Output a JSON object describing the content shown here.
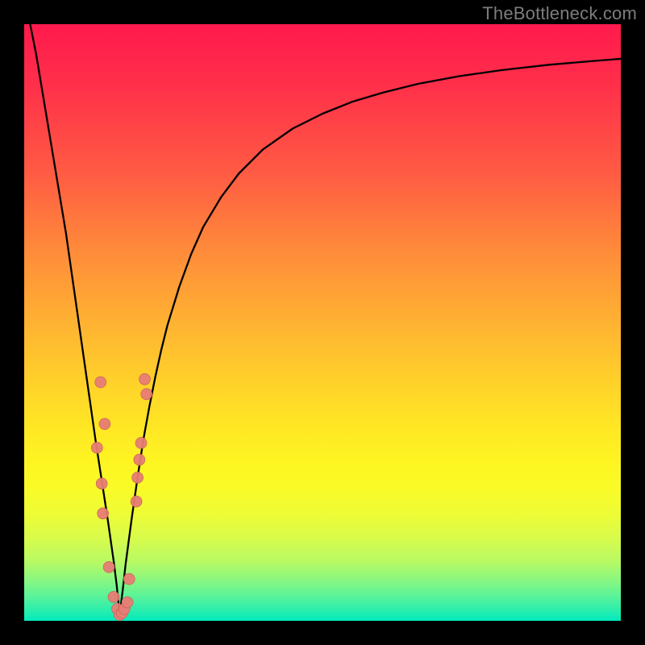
{
  "watermark": {
    "text": "TheBottleneck.com"
  },
  "colors": {
    "frame": "#000000",
    "curve": "#000000",
    "dot_fill": "#e77c74",
    "dot_stroke": "#c65b52",
    "gradient_top": "#ff1a4d",
    "gradient_bottom": "#00e9be"
  },
  "chart_data": {
    "type": "line",
    "title": "",
    "xlabel": "",
    "ylabel": "",
    "xlim": [
      0,
      100
    ],
    "ylim": [
      0,
      100
    ],
    "grid": false,
    "legend": false,
    "bottleneck_x": 16,
    "series": [
      {
        "name": "bottleneck-curve",
        "x": [
          1,
          2,
          3,
          4,
          5,
          6,
          7,
          8,
          9,
          10,
          11,
          12,
          13,
          14,
          15,
          15.5,
          16,
          16.5,
          17,
          18,
          19,
          20,
          21,
          22,
          23,
          24,
          26,
          28,
          30,
          33,
          36,
          40,
          45,
          50,
          55,
          60,
          66,
          73,
          80,
          88,
          95,
          100
        ],
        "y": [
          100,
          95,
          89,
          83,
          77,
          71,
          65,
          58,
          51,
          44,
          37,
          30,
          23.5,
          17,
          10,
          6,
          1,
          5,
          9.5,
          17,
          24,
          30.5,
          36,
          41,
          45.5,
          49.5,
          56,
          61.5,
          66,
          71,
          75,
          79,
          82.5,
          85,
          87,
          88.5,
          90,
          91.3,
          92.3,
          93.2,
          93.8,
          94.2
        ]
      }
    ],
    "points": [
      {
        "name": "pt-a",
        "x": 12.2,
        "y": 29.0
      },
      {
        "name": "pt-b",
        "x": 12.8,
        "y": 40.0
      },
      {
        "name": "pt-c",
        "x": 13.0,
        "y": 23.0
      },
      {
        "name": "pt-d",
        "x": 13.2,
        "y": 18.0
      },
      {
        "name": "pt-e",
        "x": 13.5,
        "y": 33.0
      },
      {
        "name": "pt-f",
        "x": 14.2,
        "y": 9.0
      },
      {
        "name": "pt-g",
        "x": 15.0,
        "y": 4.0
      },
      {
        "name": "pt-h",
        "x": 15.6,
        "y": 2.0
      },
      {
        "name": "pt-i",
        "x": 16.0,
        "y": 1.0
      },
      {
        "name": "pt-j",
        "x": 16.4,
        "y": 1.3
      },
      {
        "name": "pt-k",
        "x": 16.8,
        "y": 2.0
      },
      {
        "name": "pt-l",
        "x": 17.3,
        "y": 3.1
      },
      {
        "name": "pt-m",
        "x": 17.6,
        "y": 7.0
      },
      {
        "name": "pt-n",
        "x": 18.8,
        "y": 20.0
      },
      {
        "name": "pt-o",
        "x": 19.0,
        "y": 24.0
      },
      {
        "name": "pt-p",
        "x": 19.3,
        "y": 27.0
      },
      {
        "name": "pt-q",
        "x": 19.6,
        "y": 29.8
      },
      {
        "name": "pt-r",
        "x": 20.2,
        "y": 40.5
      },
      {
        "name": "pt-s",
        "x": 20.5,
        "y": 38.0
      }
    ]
  }
}
